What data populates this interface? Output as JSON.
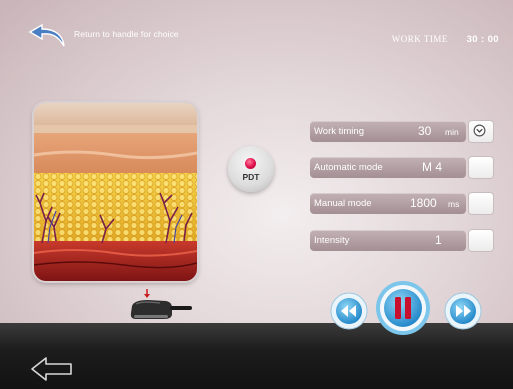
{
  "header": {
    "return_text": "Return to handle for choice",
    "work_time_label": "WORK TIME",
    "work_time_value": "30 : 00"
  },
  "mode_button": {
    "label": "PDT"
  },
  "settings": {
    "work_timing": {
      "label": "Work timing",
      "value": "30",
      "unit": "min"
    },
    "automatic_mode": {
      "label": "Automatic mode",
      "value": "M 4"
    },
    "manual_mode": {
      "label": "Manual mode",
      "value": "1800",
      "unit": "ms"
    },
    "intensity": {
      "label": "Intensity",
      "value": "1"
    }
  },
  "controls": {
    "rewind": "rewind-icon",
    "pause": "pause-icon",
    "forward": "fast-forward-icon"
  },
  "colors": {
    "accent_blue": "#2a9fd6",
    "pause_red": "#c8102e",
    "panel": "#a48f93"
  }
}
